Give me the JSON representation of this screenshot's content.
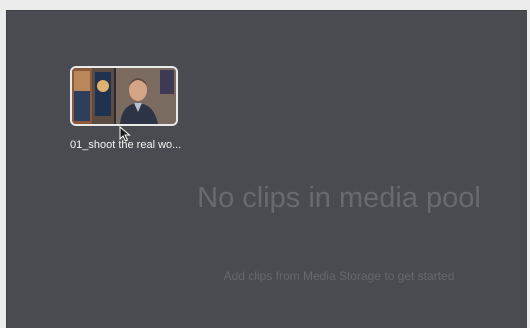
{
  "media_pool": {
    "empty_title": "No clips in media pool",
    "empty_subtitle": "Add clips from Media Storage to get started"
  },
  "clips": [
    {
      "name": "01_shoot the real wo..."
    }
  ],
  "icons": {
    "cursor": "mouse-pointer-icon"
  },
  "colors": {
    "pool_background": "#4a4b50",
    "thumbnail_border": "#e9e9ea",
    "empty_text": "#686a70"
  }
}
